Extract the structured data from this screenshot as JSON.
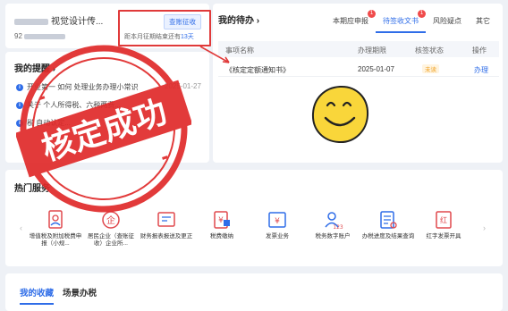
{
  "company": {
    "name_suffix": "视觉设计传...",
    "tax_id_prefix": "92",
    "check_button": "查账征收",
    "deadline_note_prefix": "距本月征期结束还有",
    "deadline_days": "13天"
  },
  "reminder": {
    "title": "我的提醒",
    "title_chevron": "›",
    "items": [
      {
        "text": "开业第一   如何 处理业务办理小常识",
        "date": "2025-01-27"
      },
      {
        "text": "关于   个人所得税、六税两费...",
        "date": ""
      },
      {
        "text": "税   自动认定...",
        "date": ""
      }
    ]
  },
  "todo": {
    "title": "我的待办",
    "title_chevron": "›",
    "tabs": [
      {
        "label": "本期应申报",
        "badge": "1",
        "active": false
      },
      {
        "label": "待签收文书",
        "badge": "1",
        "active": true
      },
      {
        "label": "风险疑点",
        "badge": "",
        "active": false
      },
      {
        "label": "其它",
        "badge": "",
        "active": false
      }
    ],
    "columns": [
      "事项名称",
      "办理期限",
      "核签状态",
      "操作"
    ],
    "rows": [
      {
        "name": "《核定定额通知书》",
        "deadline": "2025-01-07",
        "status": "未读",
        "action": "办理"
      }
    ]
  },
  "services": {
    "title": "热门服务",
    "items": [
      {
        "label": "增值税及附加税费申报（小规...",
        "icon": "tax-declare-icon"
      },
      {
        "label": "居民企业（查账征收）企业所...",
        "icon": "enterprise-tax-icon"
      },
      {
        "label": "财务报表报送及更正",
        "icon": "financial-report-icon"
      },
      {
        "label": "税费缴纳",
        "icon": "tax-payment-icon"
      },
      {
        "label": "发票业务",
        "icon": "invoice-icon"
      },
      {
        "label": "税务数字账户",
        "icon": "digital-account-icon"
      },
      {
        "label": "办税进度及结果查询",
        "icon": "progress-query-icon"
      },
      {
        "label": "红字发票开具",
        "icon": "red-invoice-icon"
      }
    ],
    "prev": "‹",
    "next": "›"
  },
  "bottom_tabs": [
    {
      "label": "我的收藏",
      "active": true
    },
    {
      "label": "场景办税",
      "active": false
    }
  ],
  "stamp": {
    "text": "核定成功"
  },
  "colors": {
    "accent": "#2f6de8",
    "stamp_red": "#e02a2a",
    "smiley_yellow": "#f9d63a"
  }
}
